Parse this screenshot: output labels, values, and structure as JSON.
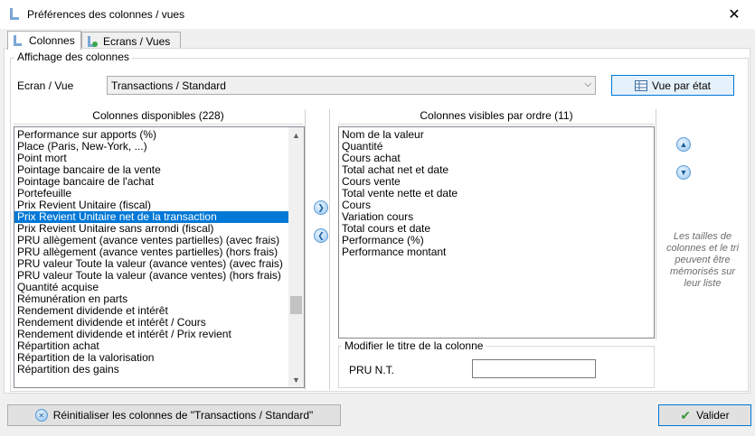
{
  "window": {
    "title": "Préférences des colonnes / vues",
    "close_glyph": "✕"
  },
  "tabs": [
    {
      "label": "Colonnes",
      "active": true
    },
    {
      "label": "Ecrans / Vues",
      "active": false
    }
  ],
  "affichage": {
    "legend": "Affichage des colonnes",
    "ecran_label": "Ecran / Vue",
    "ecran_value": "Transactions / Standard",
    "vue_par_etat_label": "Vue par état"
  },
  "available": {
    "header": "Colonnes disponibles (228)",
    "items": [
      "Performance sur apports (%)",
      "Place (Paris, New-York, ...)",
      "Point mort",
      "Pointage bancaire de la vente",
      "Pointage bancaire de l'achat",
      "Portefeuille",
      "Prix Revient Unitaire (fiscal)",
      "Prix Revient Unitaire net de la transaction",
      "Prix Revient Unitaire sans arrondi (fiscal)",
      "PRU allègement (avance ventes partielles) (avec frais)",
      "PRU allègement (avance ventes partielles) (hors frais)",
      "PRU valeur Toute la valeur (avance ventes) (avec frais)",
      "PRU valeur Toute la valeur (avance ventes) (hors frais)",
      "Quantité acquise",
      "Rémunération en parts",
      "Rendement dividende et intérêt",
      "Rendement dividende et intérêt / Cours",
      "Rendement dividende et intérêt / Prix revient",
      "Répartition achat",
      "Répartition de la valorisation",
      "Répartition des gains"
    ],
    "selected_index": 7,
    "scroll_position": 0.72
  },
  "visible": {
    "header": "Colonnes visibles par ordre (11)",
    "items": [
      "Nom de la valeur",
      "Quantité",
      "Cours achat",
      "Total achat net et date",
      "Cours vente",
      "Total vente nette et date",
      "Cours",
      "Variation cours",
      "Total cours et date",
      "Performance (%)",
      "Performance montant"
    ]
  },
  "hint": "Les tailles de colonnes et le tri peuvent être mémorisés sur leur liste",
  "modify": {
    "legend": "Modifier le titre de la colonne",
    "field_label": "PRU N.T.",
    "field_value": ""
  },
  "footer": {
    "reset_label": "Réinitialiser les colonnes de \"Transactions / Standard\"",
    "validate_label": "Valider"
  },
  "colors": {
    "accent": "#0078d7",
    "selection": "#0078d7"
  }
}
